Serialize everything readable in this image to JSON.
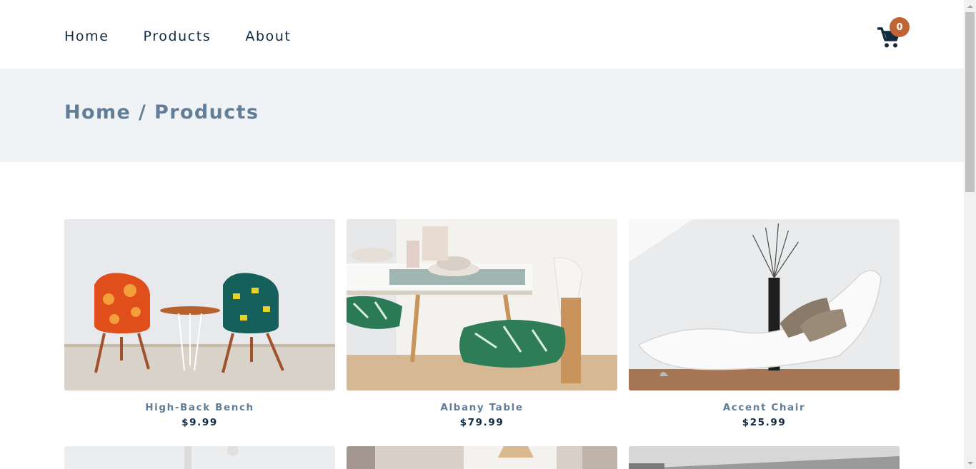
{
  "nav": {
    "links": [
      "Home",
      "Products",
      "About"
    ],
    "cart_count": "0",
    "cart_icon": "shopping-cart-icon"
  },
  "hero": {
    "breadcrumb": "Home / Products"
  },
  "products": [
    {
      "name": "High-Back Bench",
      "price": "$9.99"
    },
    {
      "name": "Albany Table",
      "price": "$79.99"
    },
    {
      "name": "Accent Chair",
      "price": "$25.99"
    }
  ],
  "colors": {
    "primary_text": "#102a42",
    "muted_text": "#617d98",
    "hero_bg": "#f0f3f6",
    "badge": "#bf6535"
  }
}
